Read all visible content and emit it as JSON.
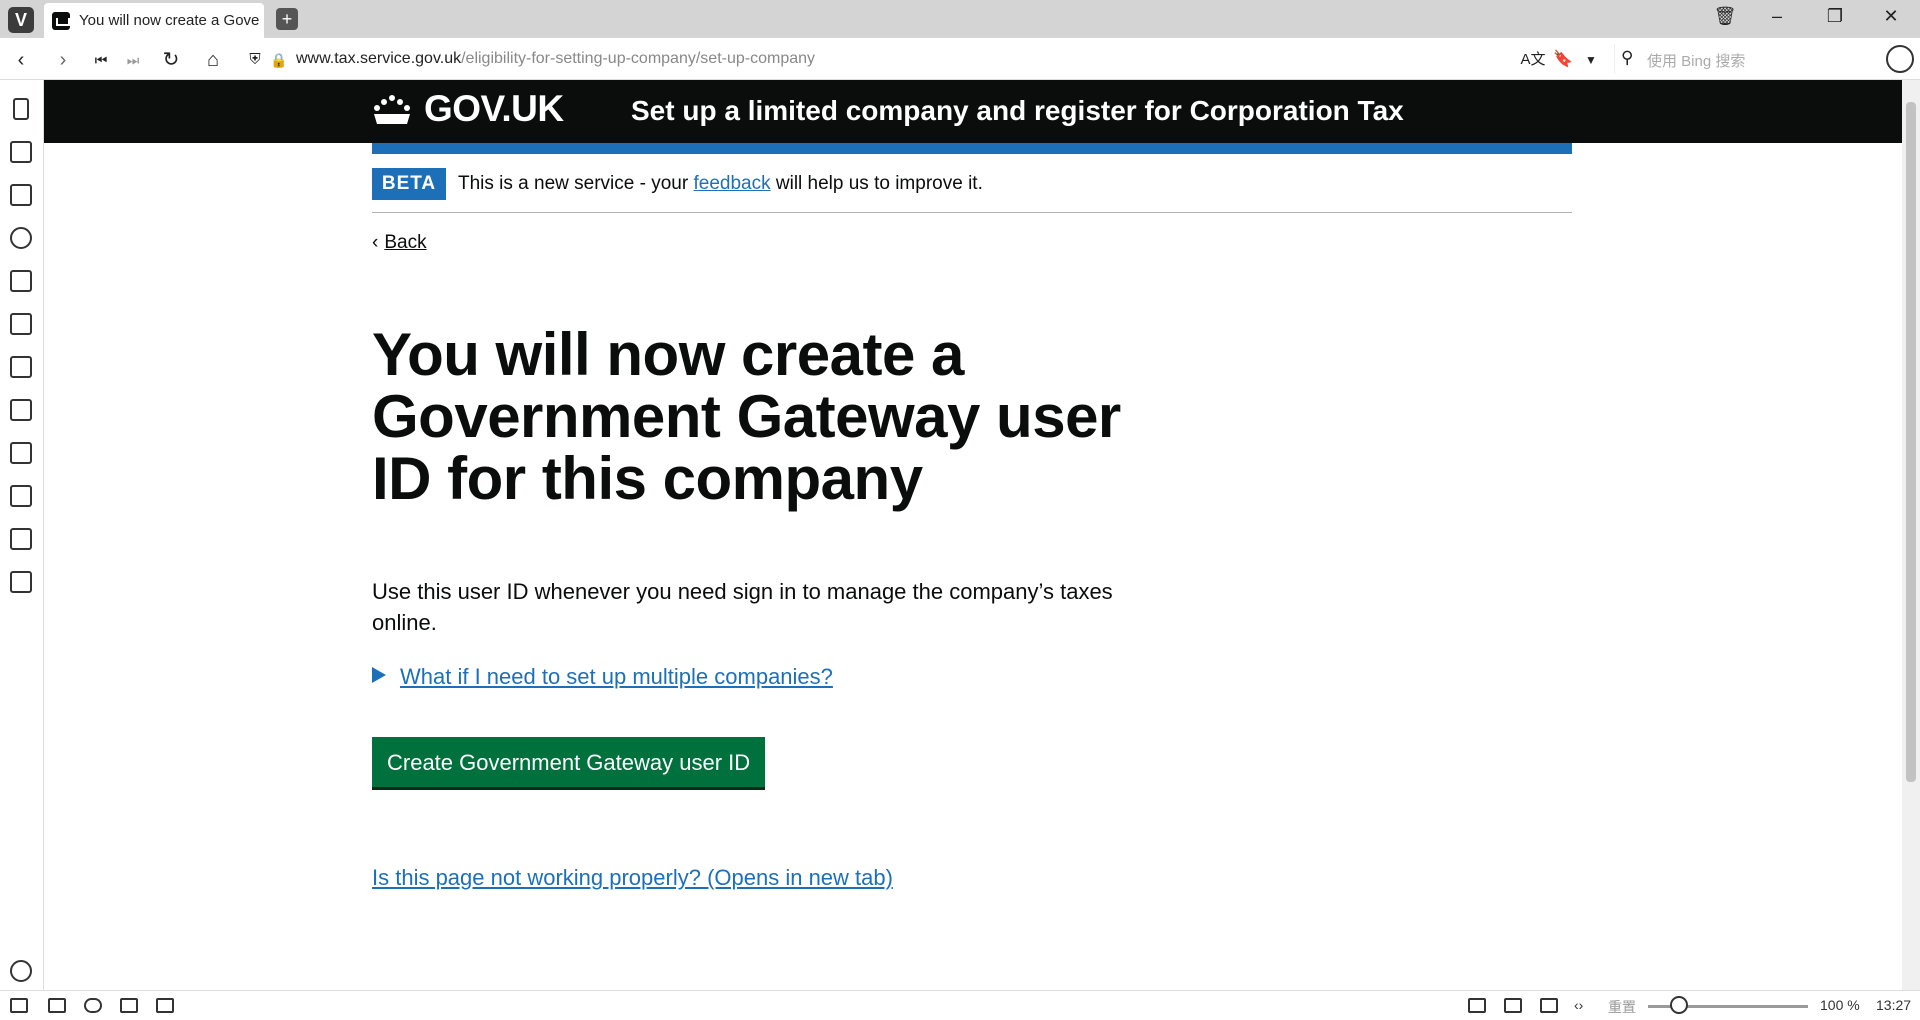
{
  "browser": {
    "tab_title": "You will now create a Gover",
    "url_host": "www.tax.service.gov.uk",
    "url_path": "/eligibility-for-setting-up-company/set-up-company",
    "search_placeholder": "使用 Bing 搜索",
    "zoom": "100 %",
    "time": "13:27",
    "reset_label": "重置"
  },
  "header": {
    "brand": "GOV.UK",
    "service_name": "Set up a limited company and register for Corporation Tax"
  },
  "phase_banner": {
    "tag": "BETA",
    "text_before": "This is a new service - your",
    "link": "feedback",
    "text_after": "will help us to improve it."
  },
  "back_link": "Back",
  "heading": "You will now create a Government Gateway user ID for this company",
  "lede": "Use this user ID whenever you need sign in to manage the company’s taxes online.",
  "details_summary": "What if I need to set up multiple companies?",
  "primary_button": "Create Government Gateway user ID",
  "report_link": "Is this page not working properly? (Opens in new tab)",
  "colors": {
    "govuk_black": "#0b0c0c",
    "govuk_blue": "#1d70b8",
    "govuk_green": "#00703c"
  }
}
